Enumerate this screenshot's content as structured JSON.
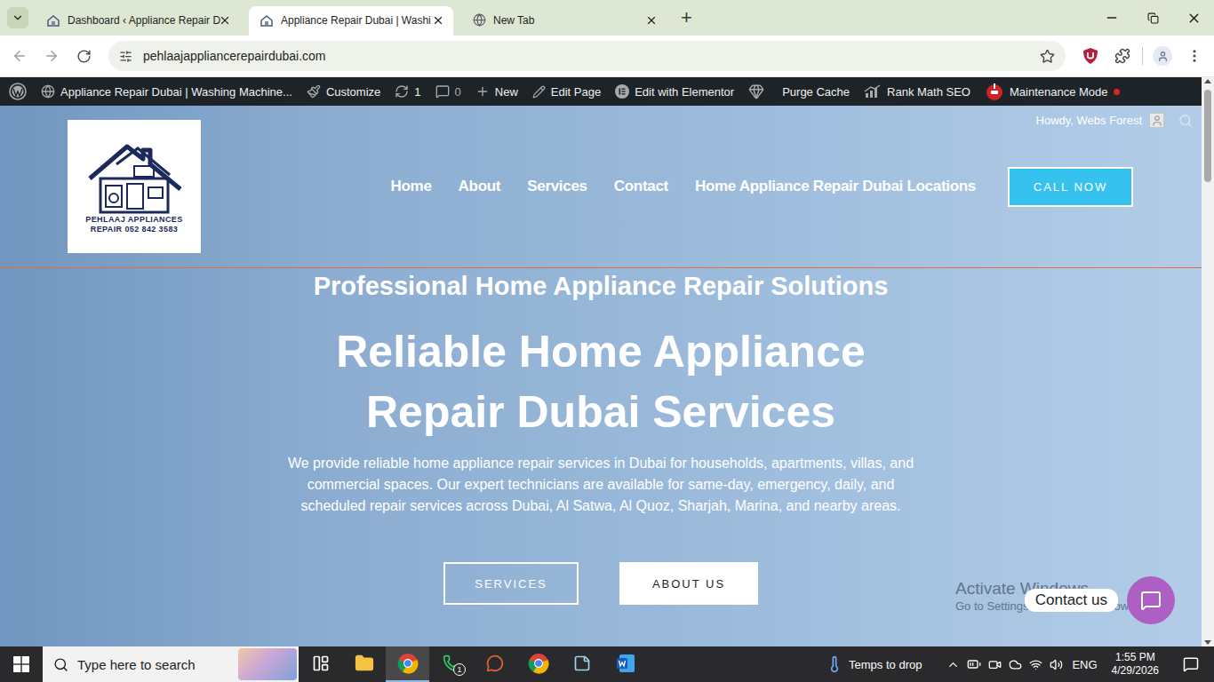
{
  "browser": {
    "tabs": [
      {
        "label": "Dashboard ‹ Appliance Repair D",
        "selected": false,
        "kind": "site"
      },
      {
        "label": "Appliance Repair Dubai | Washi",
        "selected": true,
        "kind": "site"
      },
      {
        "label": "New Tab",
        "selected": false,
        "kind": "newtab"
      }
    ],
    "new_tab": "+",
    "url": "pehlaajappliancerepairdubai.com"
  },
  "admin_bar": {
    "items": [
      {
        "kind": "wordpress",
        "dimmed": false,
        "indicator": false
      },
      {
        "kind": "site",
        "label": "Appliance Repair Dubai | Washing Machine...",
        "dimmed": false,
        "indicator": false
      },
      {
        "kind": "customize",
        "label": "Customize",
        "dimmed": false,
        "indicator": false
      },
      {
        "kind": "updates",
        "label": "1",
        "dimmed": false,
        "indicator": false
      },
      {
        "kind": "comments",
        "label": "0",
        "dimmed": true,
        "indicator": false
      },
      {
        "kind": "new",
        "label": "New",
        "dimmed": false,
        "indicator": false
      },
      {
        "kind": "edit",
        "label": "Edit Page",
        "dimmed": false,
        "indicator": false
      },
      {
        "kind": "elementor",
        "label": "Edit with Elementor",
        "dimmed": false,
        "indicator": false
      },
      {
        "kind": "purge",
        "label": "Purge Cache",
        "dimmed": false,
        "indicator": false
      },
      {
        "kind": "rankmath",
        "label": "Rank Math SEO",
        "dimmed": false,
        "indicator": false
      },
      {
        "kind": "maintenance",
        "label": "Maintenance Mode",
        "dimmed": false,
        "indicator": true
      }
    ],
    "howdy": "Howdy, Webs Forest"
  },
  "site": {
    "logo": {
      "lines": [
        "PEHLAAJ APPLIANCES",
        "REPAIR 052 842 3583"
      ]
    },
    "nav": [
      "Home",
      "About",
      "Services",
      "Contact",
      "Home Appliance Repair Dubai Locations"
    ],
    "cta": "CALL NOW"
  },
  "hero": {
    "subtitle": "Professional Home Appliance Repair Solutions",
    "title": "Reliable Home Appliance Repair Dubai Services",
    "description": "We provide reliable home appliance repair services in Dubai for households, apartments, villas, and commercial spaces. Our expert technicians are available for same-day, emergency, daily, and scheduled repair services across Dubai, Al Satwa, Al Quoz, Sharjah, Marina, and nearby areas.",
    "buttons": [
      {
        "label": "SERVICES",
        "kind": "outline"
      },
      {
        "label": "ABOUT US",
        "kind": "solid"
      }
    ]
  },
  "contact_widget": {
    "label": "Contact us"
  },
  "watermark": {
    "lines": [
      "Activate Windows",
      "Go to Settings to activate Windows."
    ]
  },
  "taskbar": {
    "search_placeholder": "Type here to search",
    "apps": [
      {
        "kind": "task-view",
        "active": false
      },
      {
        "kind": "explorer",
        "active": false
      },
      {
        "kind": "chrome",
        "active": true
      },
      {
        "kind": "whatsapp",
        "active": false,
        "badge": "1"
      },
      {
        "kind": "app",
        "active": false
      },
      {
        "kind": "chrome-profile",
        "active": false
      },
      {
        "kind": "notes",
        "active": false
      },
      {
        "kind": "word",
        "active": false
      }
    ],
    "weather": "Temps to drop",
    "language": "ENG",
    "time": "1:55 PM",
    "date": "4/29/2026"
  }
}
